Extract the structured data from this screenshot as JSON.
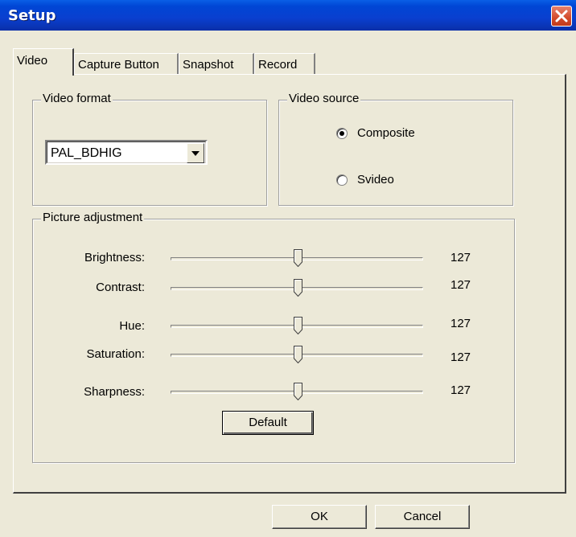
{
  "window": {
    "title": "Setup"
  },
  "tabs": [
    {
      "label": "Video"
    },
    {
      "label": "Capture Button"
    },
    {
      "label": "Snapshot"
    },
    {
      "label": "Record"
    }
  ],
  "video_format": {
    "title": "Video format",
    "selected": "PAL_BDHIG"
  },
  "video_source": {
    "title": "Video source",
    "options": [
      {
        "label": "Composite",
        "selected": true
      },
      {
        "label": "Svideo",
        "selected": false
      }
    ]
  },
  "picture_adjustment": {
    "title": "Picture adjustment",
    "sliders": [
      {
        "label": "Brightness:",
        "value": "127"
      },
      {
        "label": "Contrast:",
        "value": "127"
      },
      {
        "label": "Hue:",
        "value": "127"
      },
      {
        "label": "Saturation:",
        "value": "127"
      },
      {
        "label": "Sharpness:",
        "value": "127"
      }
    ],
    "default_label": "Default"
  },
  "buttons": {
    "ok": "OK",
    "cancel": "Cancel"
  }
}
